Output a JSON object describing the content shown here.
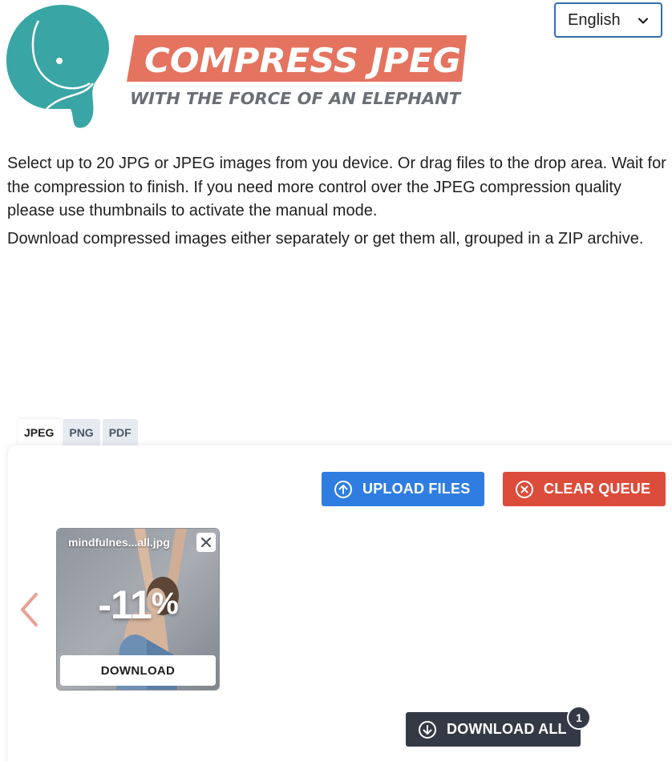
{
  "header": {
    "logo_title": "COMPRESS JPEG",
    "logo_subtitle": "WITH THE FORCE OF AN ELEPHANT",
    "language": "English"
  },
  "intro": {
    "paragraph1": "Select up to 20 JPG or JPEG images from you device. Or drag files to the drop area. Wait for the compression to finish. If you need more control over the JPEG compression quality please use thumbnails to activate the manual mode.",
    "paragraph2": "Download compressed images either separately or get them all, grouped in a ZIP archive."
  },
  "tabs": [
    {
      "label": "JPEG",
      "active": true
    },
    {
      "label": "PNG",
      "active": false
    },
    {
      "label": "PDF",
      "active": false
    }
  ],
  "toolbar": {
    "upload_label": "UPLOAD FILES",
    "clear_label": "CLEAR QUEUE",
    "download_all_label": "DOWNLOAD ALL",
    "download_all_count": "1"
  },
  "queue": [
    {
      "filename": "mindfulnes...all.jpg",
      "reduction": "-11",
      "unit": "%",
      "download_label": "DOWNLOAD"
    }
  ],
  "colors": {
    "brand_teal": "#3aa5a5",
    "brand_salmon": "#e4735f",
    "upload_blue": "#2f7de1",
    "clear_red": "#dc4c3b",
    "download_dark": "#343a45"
  },
  "icons": {
    "language_select": "chevron-down-icon",
    "upload": "arrow-up-circle-icon",
    "clear": "x-circle-icon",
    "download_all": "arrow-down-circle-icon",
    "prev": "chevron-left-icon",
    "remove": "close-icon"
  }
}
